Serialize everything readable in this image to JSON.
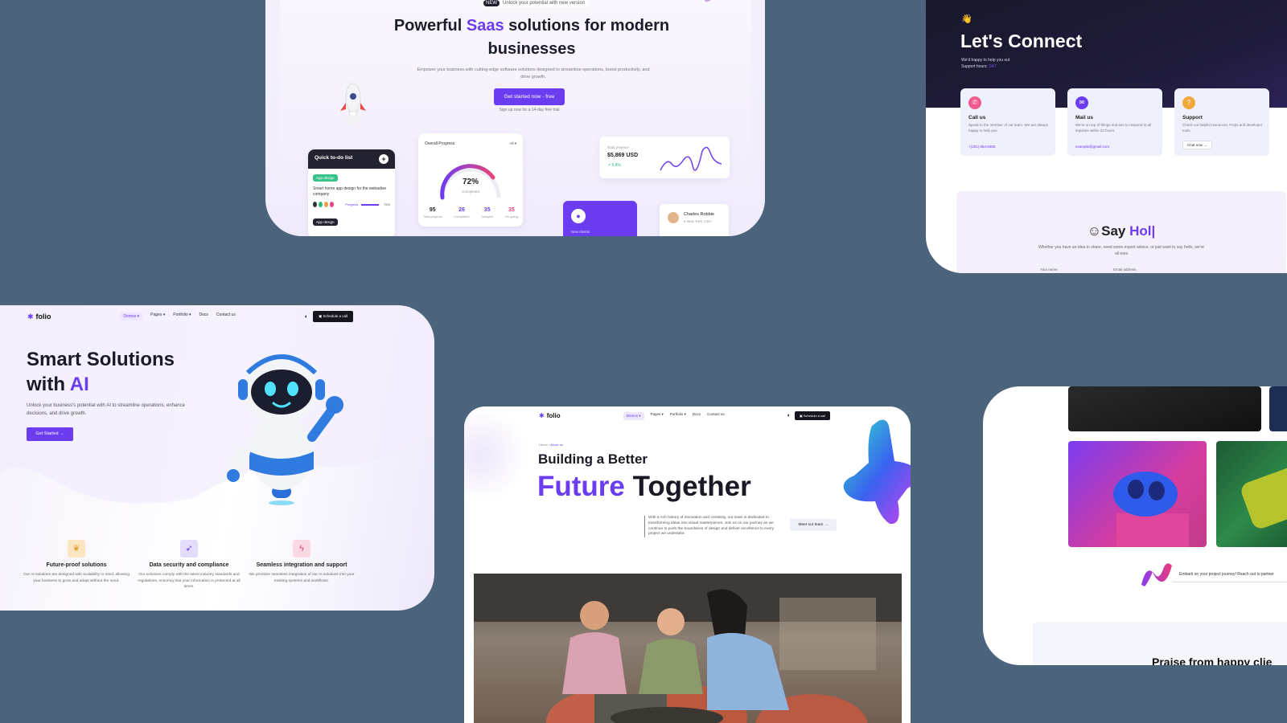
{
  "saas": {
    "badge_tag": "NEW",
    "badge_text": "Unlock your potential with new version",
    "title_pre": "Powerful ",
    "title_accent": "Saas",
    "title_post": " solutions for modern businesses",
    "subtitle": "Empower your business with cutting-edge software solutions designed to streamline operations, boost productivity, and drive growth.",
    "cta": "Get started now - free",
    "cta_note": "Sign up now for a 14-day free trial",
    "todo": {
      "title": "Quick to-do list",
      "tag1": "App design",
      "text": "Smart home app design for the webadise company",
      "progress_label": "Progress",
      "progress_value": "75%",
      "tag2": "App design"
    },
    "progress": {
      "title": "Overall Progress",
      "filter": "All",
      "percent": "72%",
      "percent_label": "Completed",
      "stats": [
        {
          "value": "95",
          "label": "Total projects",
          "color": "#222222"
        },
        {
          "value": "26",
          "label": "Completed",
          "color": "#6c3cf0"
        },
        {
          "value": "35",
          "label": "Delayed",
          "color": "#6c3cf0"
        },
        {
          "value": "35",
          "label": "On going",
          "color": "#e8457a"
        }
      ]
    },
    "revenue": {
      "label": "Total revenue",
      "value": "$5,869 USD",
      "change": "5.8%"
    },
    "clients": {
      "label": "New clients"
    },
    "profile": {
      "name": "Charles Robbie",
      "location": "New York, USA"
    }
  },
  "connect": {
    "title": "Let's Connect",
    "subtitle_line1": "We'd happy to help you out",
    "subtitle_line2": "Support hours:",
    "subtitle_accent": "24/7",
    "cards": [
      {
        "title": "Call us",
        "desc": "Speak to the member of our team. We are always happy to help you.",
        "link": "+(251) 854-6308",
        "icon": "phone-icon",
        "color": "#f05a8c"
      },
      {
        "title": "Mail us",
        "desc": "We're on top of things and aim to respond to all inquiries within 24 hours.",
        "link": "example@gmail.com",
        "icon": "mail-icon",
        "color": "#6c3cf0"
      },
      {
        "title": "Support",
        "desc": "Check out helpful resources, FAQs and developer tools.",
        "link": "Chat now",
        "icon": "support-icon",
        "color": "#f2a93b"
      }
    ],
    "hello_title": "Say ",
    "hello_accent": "Hol|",
    "hello_desc": "Whether you have an idea to share, need some expert advice, or just want to say hello, we're all ears",
    "field1": "Your name",
    "field2": "Email address"
  },
  "ai": {
    "brand": "folio",
    "nav": [
      "Demos",
      "Pages",
      "Portfolio",
      "Docs",
      "Contact us"
    ],
    "schedule": "Schedule a call",
    "title_line1": "Smart Solutions",
    "title_line2_pre": "with ",
    "title_accent": "AI",
    "subtitle": "Unlock your business's potential with AI to streamline operations, enhance decisions, and drive growth.",
    "cta": "Get Started",
    "features": [
      {
        "title": "Future-proof solutions",
        "desc": "Our AI solutions are designed with scalability in mind, allowing your business to grow and adapt without the need.",
        "icon": "leaf-icon",
        "bg": "#fbe6c2",
        "fg": "#e7a23b"
      },
      {
        "title": "Data security and compliance",
        "desc": "Our solutions comply with the latest industry standards and regulations, ensuring that your information is protected at all times.",
        "icon": "rocket-icon",
        "bg": "#e4dcfb",
        "fg": "#6c3cf0"
      },
      {
        "title": "Seamless integration and support",
        "desc": "We prioritize seamless integration of our AI solutions into your existing systems and workflows.",
        "icon": "bolt-icon",
        "bg": "#fbd9e4",
        "fg": "#e8457a"
      }
    ]
  },
  "about": {
    "brand": "folio",
    "nav": [
      "Demos",
      "Pages",
      "Portfolio",
      "Docs",
      "Contact us"
    ],
    "schedule": "Schedule a call",
    "crumb_home": "Home",
    "crumb_current": "About us",
    "title1": "Building a Better",
    "title2_accent": "Future",
    "title2_rest": " Together",
    "paragraph": "With a rich history of innovation and creativity, our team is dedicated to transforming ideas into visual masterpieces. Join us on our journey as we continue to push the boundaries of design and deliver excellence in every project we undertake.",
    "team_button": "Meet our team"
  },
  "portfolio": {
    "cta_text": "Embark on your project journey! Reach out to partner",
    "praise": "Praise from happy clie"
  }
}
